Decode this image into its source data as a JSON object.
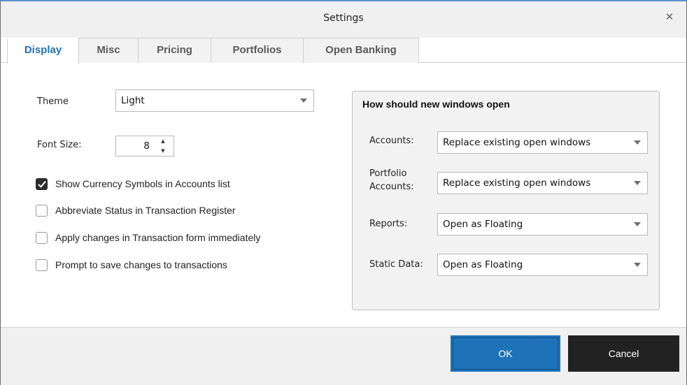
{
  "window": {
    "title": "Settings",
    "close_icon": "close-icon"
  },
  "tabs": [
    {
      "label": "Display",
      "active": true
    },
    {
      "label": "Misc",
      "active": false
    },
    {
      "label": "Pricing",
      "active": false
    },
    {
      "label": "Portfolios",
      "active": false
    },
    {
      "label": "Open Banking",
      "active": false
    }
  ],
  "display": {
    "theme_label": "Theme",
    "theme_value": "Light",
    "font_size_label": "Font Size:",
    "font_size_value": "8",
    "checkboxes": [
      {
        "label": "Show Currency Symbols in Accounts list",
        "checked": true
      },
      {
        "label": "Abbreviate Status in Transaction Register",
        "checked": false
      },
      {
        "label": "Apply changes in Transaction form immediately",
        "checked": false
      },
      {
        "label": "Prompt to save changes to transactions",
        "checked": false
      }
    ]
  },
  "windows_group": {
    "title": "How should new windows open",
    "rows": [
      {
        "label": "Accounts:",
        "value": "Replace existing open windows"
      },
      {
        "label": "Portfolio Accounts:",
        "value": "Replace existing open windows"
      },
      {
        "label": "Reports:",
        "value": "Open as Floating"
      },
      {
        "label": "Static Data:",
        "value": "Open as Floating"
      }
    ]
  },
  "footer": {
    "ok_label": "OK",
    "cancel_label": "Cancel"
  },
  "colors": {
    "accent": "#1e72b8",
    "cancel_bg": "#222222",
    "active_tab_text": "#1e72b8"
  }
}
